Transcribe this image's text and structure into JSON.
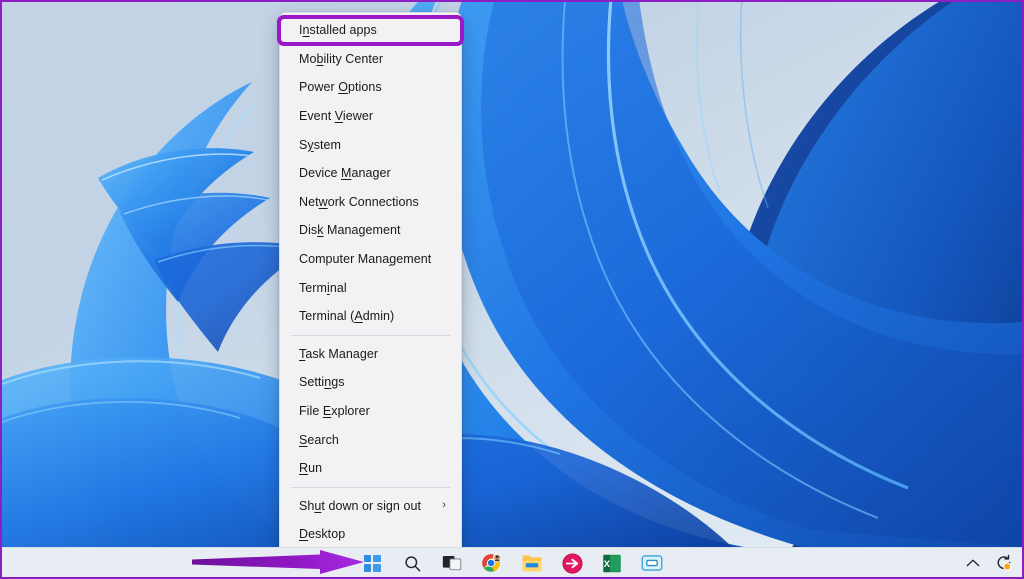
{
  "desktop": {
    "wallpaper_name": "windows-11-bloom-wallpaper",
    "background_color": "#c9d8e7"
  },
  "annotation": {
    "arrow_name": "purple-pointer-arrow",
    "arrow_color": "#9b18c8",
    "highlight_box_color": "#9b18c8",
    "highlight_target": "Installed apps"
  },
  "winx_menu": {
    "title": "Win+X Power User Menu",
    "background_color": "#f2f2f5",
    "items": [
      {
        "label": "Installed apps",
        "accel": "n",
        "highlighted": true,
        "separator_after": false,
        "submenu": false
      },
      {
        "label": "Mobility Center",
        "accel": "b",
        "highlighted": false,
        "separator_after": false,
        "submenu": false
      },
      {
        "label": "Power Options",
        "accel": "O",
        "highlighted": false,
        "separator_after": false,
        "submenu": false
      },
      {
        "label": "Event Viewer",
        "accel": "V",
        "highlighted": false,
        "separator_after": false,
        "submenu": false
      },
      {
        "label": "System",
        "accel": "y",
        "highlighted": false,
        "separator_after": false,
        "submenu": false
      },
      {
        "label": "Device Manager",
        "accel": "M",
        "highlighted": false,
        "separator_after": false,
        "submenu": false
      },
      {
        "label": "Network Connections",
        "accel": "w",
        "highlighted": false,
        "separator_after": false,
        "submenu": false
      },
      {
        "label": "Disk Management",
        "accel": "k",
        "highlighted": false,
        "separator_after": false,
        "submenu": false
      },
      {
        "label": "Computer Management",
        "accel": "g",
        "highlighted": false,
        "separator_after": false,
        "submenu": false
      },
      {
        "label": "Terminal",
        "accel": "i",
        "highlighted": false,
        "separator_after": false,
        "submenu": false
      },
      {
        "label": "Terminal (Admin)",
        "accel": "A",
        "highlighted": false,
        "separator_after": true,
        "submenu": false
      },
      {
        "label": "Task Manager",
        "accel": "T",
        "highlighted": false,
        "separator_after": false,
        "submenu": false
      },
      {
        "label": "Settings",
        "accel": "n",
        "highlighted": false,
        "separator_after": false,
        "submenu": false
      },
      {
        "label": "File Explorer",
        "accel": "E",
        "highlighted": false,
        "separator_after": false,
        "submenu": false
      },
      {
        "label": "Search",
        "accel": "S",
        "highlighted": false,
        "separator_after": false,
        "submenu": false
      },
      {
        "label": "Run",
        "accel": "R",
        "highlighted": false,
        "separator_after": true,
        "submenu": false
      },
      {
        "label": "Shut down or sign out",
        "accel": "u",
        "highlighted": false,
        "separator_after": false,
        "submenu": true,
        "submenu_glyph": "›"
      },
      {
        "label": "Desktop",
        "accel": "D",
        "highlighted": false,
        "separator_after": false,
        "submenu": false
      }
    ]
  },
  "taskbar": {
    "background_color": "#e8edf3",
    "buttons": [
      {
        "name": "start-button",
        "tooltip": "Start",
        "icon": "windows-logo-icon",
        "running": false
      },
      {
        "name": "search-button",
        "tooltip": "Search",
        "icon": "search-icon",
        "running": false
      },
      {
        "name": "task-view-button",
        "tooltip": "Task view",
        "icon": "task-view-icon",
        "running": false
      },
      {
        "name": "chrome-button",
        "tooltip": "Google Chrome",
        "icon": "chrome-icon",
        "running": true
      },
      {
        "name": "file-explorer-button",
        "tooltip": "File Explorer",
        "icon": "folder-icon",
        "running": true
      },
      {
        "name": "red-app-button",
        "tooltip": "Pinned app",
        "icon": "red-arrow-circle-icon",
        "running": true
      },
      {
        "name": "excel-button",
        "tooltip": "Excel",
        "icon": "excel-icon",
        "running": true
      },
      {
        "name": "blue-app-button",
        "tooltip": "Pinned app",
        "icon": "blue-window-icon",
        "running": true
      }
    ],
    "tray": [
      {
        "name": "show-hidden-icons-button",
        "tooltip": "Show hidden icons",
        "icon": "chevron-up-icon"
      },
      {
        "name": "update-status-button",
        "tooltip": "Windows Update",
        "icon": "update-refresh-icon"
      }
    ]
  }
}
